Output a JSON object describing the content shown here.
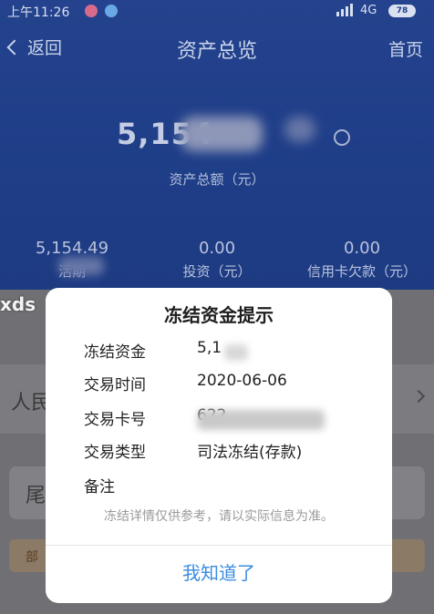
{
  "status_bar": {
    "time": "上午11:26",
    "network": "4G",
    "battery": "78"
  },
  "nav": {
    "back_label": "返回",
    "title": "资产总览",
    "home_label": "首页"
  },
  "summary": {
    "total_amount": "5,154",
    "total_label": "资产总额（元）",
    "stats": [
      {
        "value": "5,154.49",
        "label": "活期"
      },
      {
        "value": "0.00",
        "label": "投资（元）"
      },
      {
        "value": "0.00",
        "label": "信用卡欠款（元）"
      }
    ]
  },
  "background": {
    "card_row_text": "人民",
    "card_2_text": "尾",
    "strip_text": "部"
  },
  "watermark": "xds",
  "dialog": {
    "title": "冻结资金提示",
    "rows": [
      {
        "key": "冻结资金",
        "value": "5,1"
      },
      {
        "key": "交易时间",
        "value": "2020-06-06"
      },
      {
        "key": "交易卡号",
        "value": "622"
      },
      {
        "key": "交易类型",
        "value": "司法冻结(存款)"
      },
      {
        "key": "备注",
        "value": ""
      }
    ],
    "note": "冻结详情仅供参考，请以实际信息为准。",
    "confirm_label": "我知道了"
  },
  "colors": {
    "header_blue": "#1f3e88",
    "confirm_blue": "#3b8ce0",
    "overlay_gray": "#6f6f74"
  }
}
